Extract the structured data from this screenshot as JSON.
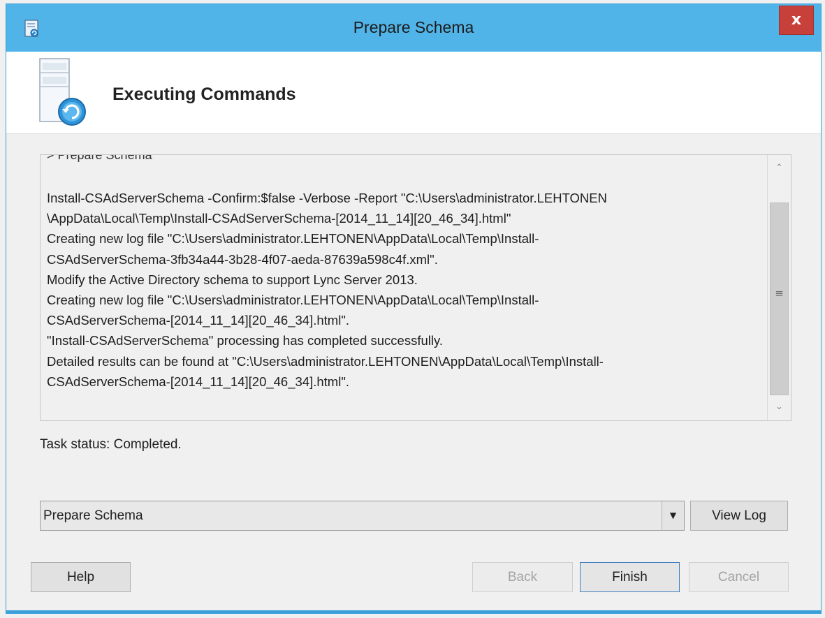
{
  "window": {
    "title": "Prepare Schema",
    "close_label": "x"
  },
  "header": {
    "title": "Executing Commands"
  },
  "log": {
    "cut_line": "> Prepare Schema",
    "lines": [
      "Install-CSAdServerSchema -Confirm:$false -Verbose -Report \"C:\\Users\\administrator.LEHTONEN",
      "\\AppData\\Local\\Temp\\Install-CSAdServerSchema-[2014_11_14][20_46_34].html\"",
      "Creating new log file \"C:\\Users\\administrator.LEHTONEN\\AppData\\Local\\Temp\\Install-",
      "CSAdServerSchema-3fb34a44-3b28-4f07-aeda-87639a598c4f.xml\".",
      "Modify the Active Directory schema to support Lync Server 2013.",
      "Creating new log file \"C:\\Users\\administrator.LEHTONEN\\AppData\\Local\\Temp\\Install-",
      "CSAdServerSchema-[2014_11_14][20_46_34].html\".",
      "\"Install-CSAdServerSchema\" processing has completed successfully.",
      "Detailed results can be found at \"C:\\Users\\administrator.LEHTONEN\\AppData\\Local\\Temp\\Install-",
      "CSAdServerSchema-[2014_11_14][20_46_34].html\"."
    ]
  },
  "status": {
    "text": "Task status: Completed."
  },
  "task_select": {
    "value": "Prepare Schema"
  },
  "buttons": {
    "view_log": "View Log",
    "help": "Help",
    "back": "Back",
    "finish": "Finish",
    "cancel": "Cancel"
  },
  "colors": {
    "titlebar": "#51b4e8",
    "close_button": "#c7403a"
  },
  "icons": {
    "title": "setup-wizard-icon",
    "header": "server-refresh-icon",
    "scroll_up": "chevron-up-icon",
    "scroll_down": "chevron-down-icon",
    "dropdown": "triangle-down-icon"
  }
}
